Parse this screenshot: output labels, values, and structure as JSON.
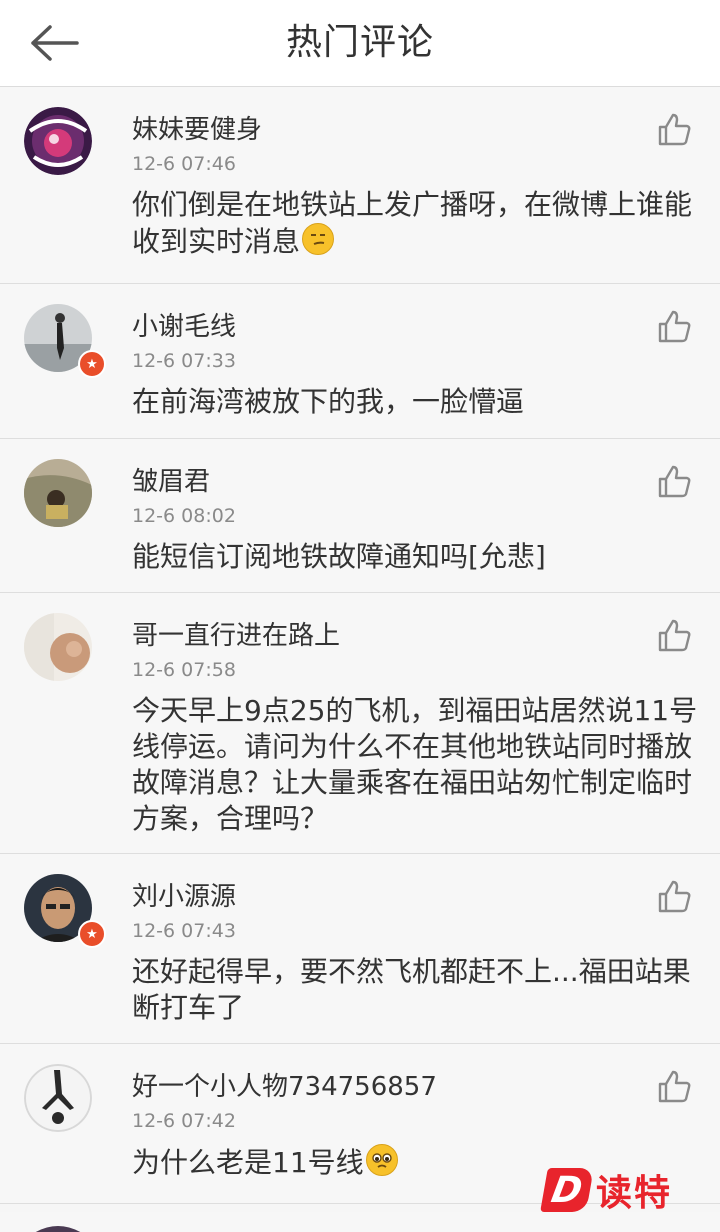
{
  "header": {
    "title": "热门评论"
  },
  "comments": [
    {
      "user": "妹妹要健身",
      "time": "12-6 07:46",
      "text": "你们倒是在地铁站上发广播呀，在微博上谁能收到实时消息",
      "verified": false
    },
    {
      "user": "小谢毛线",
      "time": "12-6 07:33",
      "text": "在前海湾被放下的我，一脸懵逼",
      "verified": true
    },
    {
      "user": "皱眉君",
      "time": "12-6 08:02",
      "text": "能短信订阅地铁故障通知吗[允悲]",
      "verified": false
    },
    {
      "user": "哥一直行进在路上",
      "time": "12-6 07:58",
      "text": "今天早上9点25的飞机，到福田站居然说11号线停运。请问为什么不在其他地铁站同时播放故障消息？让大量乘客在福田站匆忙制定临时方案，合理吗？",
      "verified": false
    },
    {
      "user": "刘小源源",
      "time": "12-6 07:43",
      "text": "还好起得早，要不然飞机都赶不上...福田站果断打车了",
      "verified": true
    },
    {
      "user": "好一个小人物734756857",
      "time": "12-6 07:42",
      "text": "为什么老是11号线",
      "verified": false
    }
  ],
  "watermark": {
    "badge": "D",
    "text": "读特"
  },
  "colors": {
    "accent": "#e8242c",
    "badge": "#e94e2a"
  }
}
